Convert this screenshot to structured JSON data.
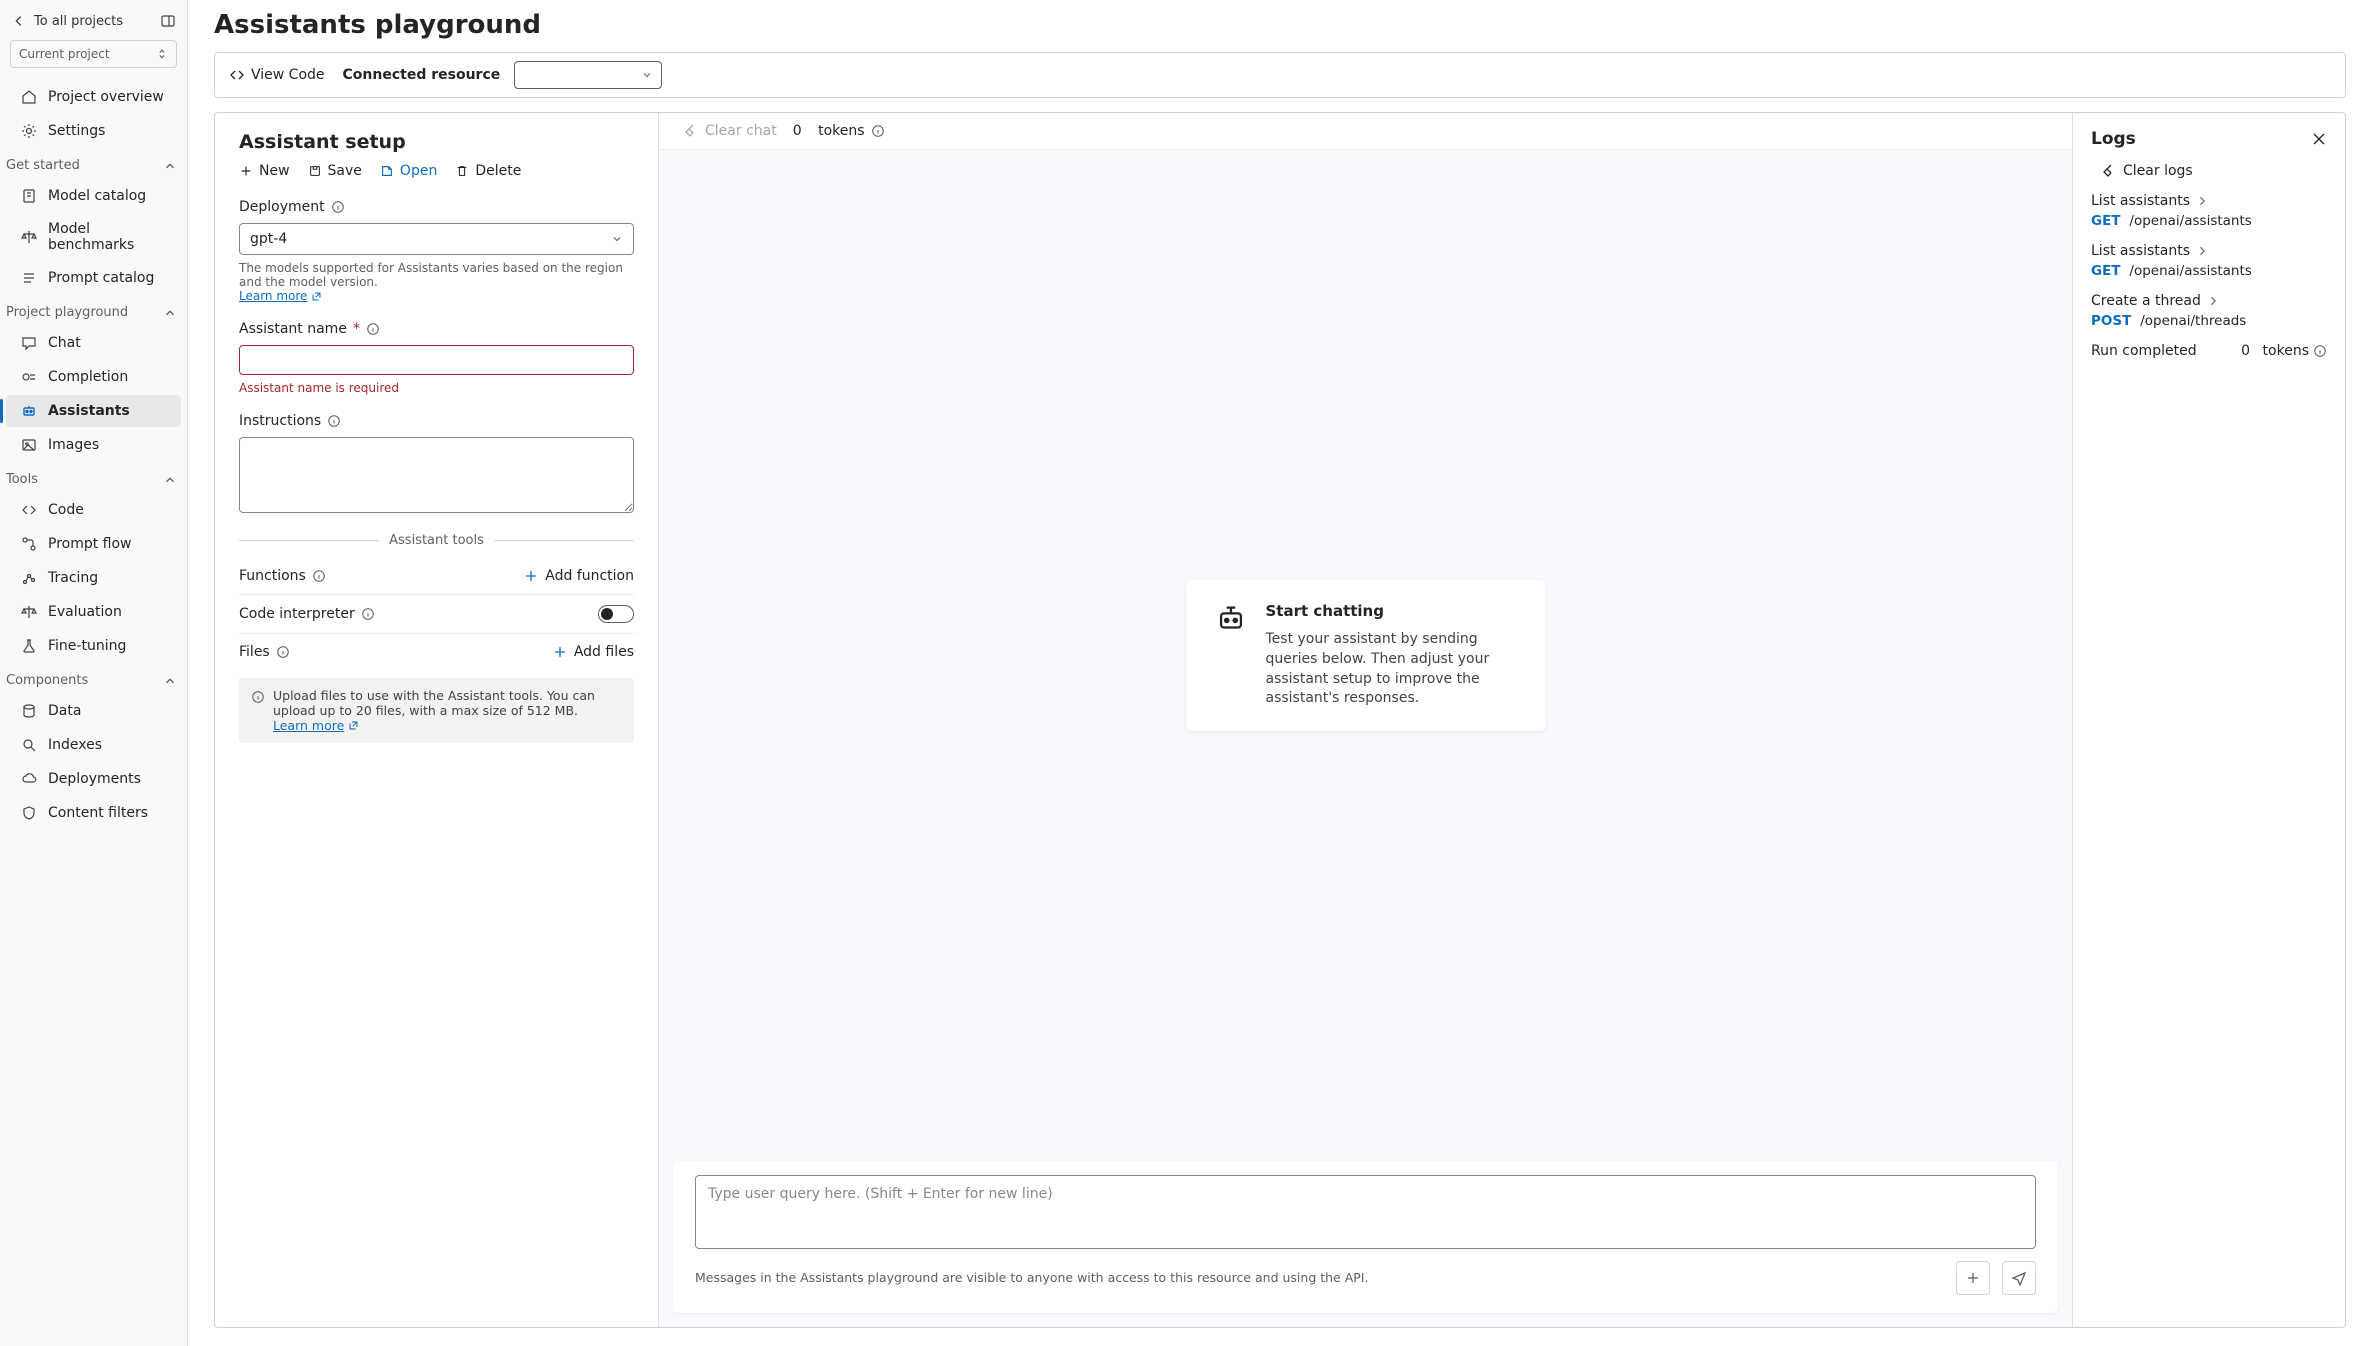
{
  "sidebar": {
    "back": "To all projects",
    "project_label": "Current project",
    "overview": "Project overview",
    "settings": "Settings",
    "sections": {
      "get_started": {
        "title": "Get started",
        "items": [
          "Model catalog",
          "Model benchmarks",
          "Prompt catalog"
        ]
      },
      "playground": {
        "title": "Project playground",
        "items": [
          "Chat",
          "Completion",
          "Assistants",
          "Images"
        ]
      },
      "tools": {
        "title": "Tools",
        "items": [
          "Code",
          "Prompt flow",
          "Tracing",
          "Evaluation",
          "Fine-tuning"
        ]
      },
      "components": {
        "title": "Components",
        "items": [
          "Data",
          "Indexes",
          "Deployments",
          "Content filters"
        ]
      }
    }
  },
  "header": {
    "title": "Assistants playground",
    "view_code": "View Code",
    "connected_label": "Connected resource",
    "connected_value": ""
  },
  "setup": {
    "title": "Assistant setup",
    "actions": {
      "new": "New",
      "save": "Save",
      "open": "Open",
      "delete": "Delete"
    },
    "deployment": {
      "label": "Deployment",
      "value": "gpt-4",
      "help": "The models supported for Assistants varies based on the region and the model version.",
      "learn_more": "Learn more"
    },
    "name": {
      "label": "Assistant name",
      "value": "",
      "error": "Assistant name is required"
    },
    "instructions": {
      "label": "Instructions",
      "value": ""
    },
    "tools_title": "Assistant tools",
    "functions": {
      "label": "Functions",
      "add": "Add function"
    },
    "code_interpreter": {
      "label": "Code interpreter",
      "enabled": false
    },
    "files": {
      "label": "Files",
      "add": "Add files",
      "note": "Upload files to use with the Assistant tools. You can upload up to 20 files, with a max size of 512 MB.",
      "learn_more": "Learn more"
    }
  },
  "chat": {
    "clear": "Clear chat",
    "tokens_count": "0",
    "tokens_label": "tokens",
    "start_title": "Start chatting",
    "start_body": "Test your assistant by sending queries below. Then adjust your assistant setup to improve the assistant's responses.",
    "placeholder": "Type user query here. (Shift + Enter for new line)",
    "hint": "Messages in the Assistants playground are visible to anyone with access to this resource and using the API."
  },
  "logs": {
    "title": "Logs",
    "clear": "Clear logs",
    "entries": [
      {
        "title": "List assistants",
        "method": "GET",
        "path": "/openai/assistants"
      },
      {
        "title": "List assistants",
        "method": "GET",
        "path": "/openai/assistants"
      },
      {
        "title": "Create a thread",
        "method": "POST",
        "path": "/openai/threads"
      }
    ],
    "run_label": "Run completed",
    "run_tokens_count": "0",
    "run_tokens_label": "tokens"
  }
}
